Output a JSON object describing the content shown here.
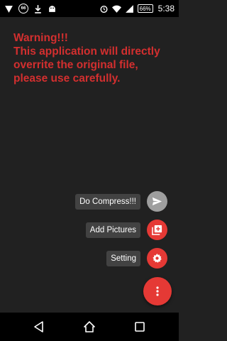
{
  "status_bar": {
    "left_icons": [
      "notification-triangle-icon",
      "badge-66-icon",
      "download-icon",
      "android-icon"
    ],
    "badge_text": "66",
    "battery_text": "66%",
    "time": "5:38"
  },
  "warning_text": "Warning!!!\n This application will directly overrite the original file, please use carefully.",
  "fab_menu": {
    "items": [
      {
        "label": "Do Compress!!!",
        "icon": "send-icon",
        "color": "#9e9e9e"
      },
      {
        "label": "Add Pictures",
        "icon": "add-photo-icon",
        "color": "#e53935"
      },
      {
        "label": "Setting",
        "icon": "gear-icon",
        "color": "#e53935"
      }
    ],
    "main_icon": "more-vertical-icon",
    "accent_color": "#e53935"
  },
  "colors": {
    "background": "#212121",
    "warning_text": "#d32f2f"
  }
}
